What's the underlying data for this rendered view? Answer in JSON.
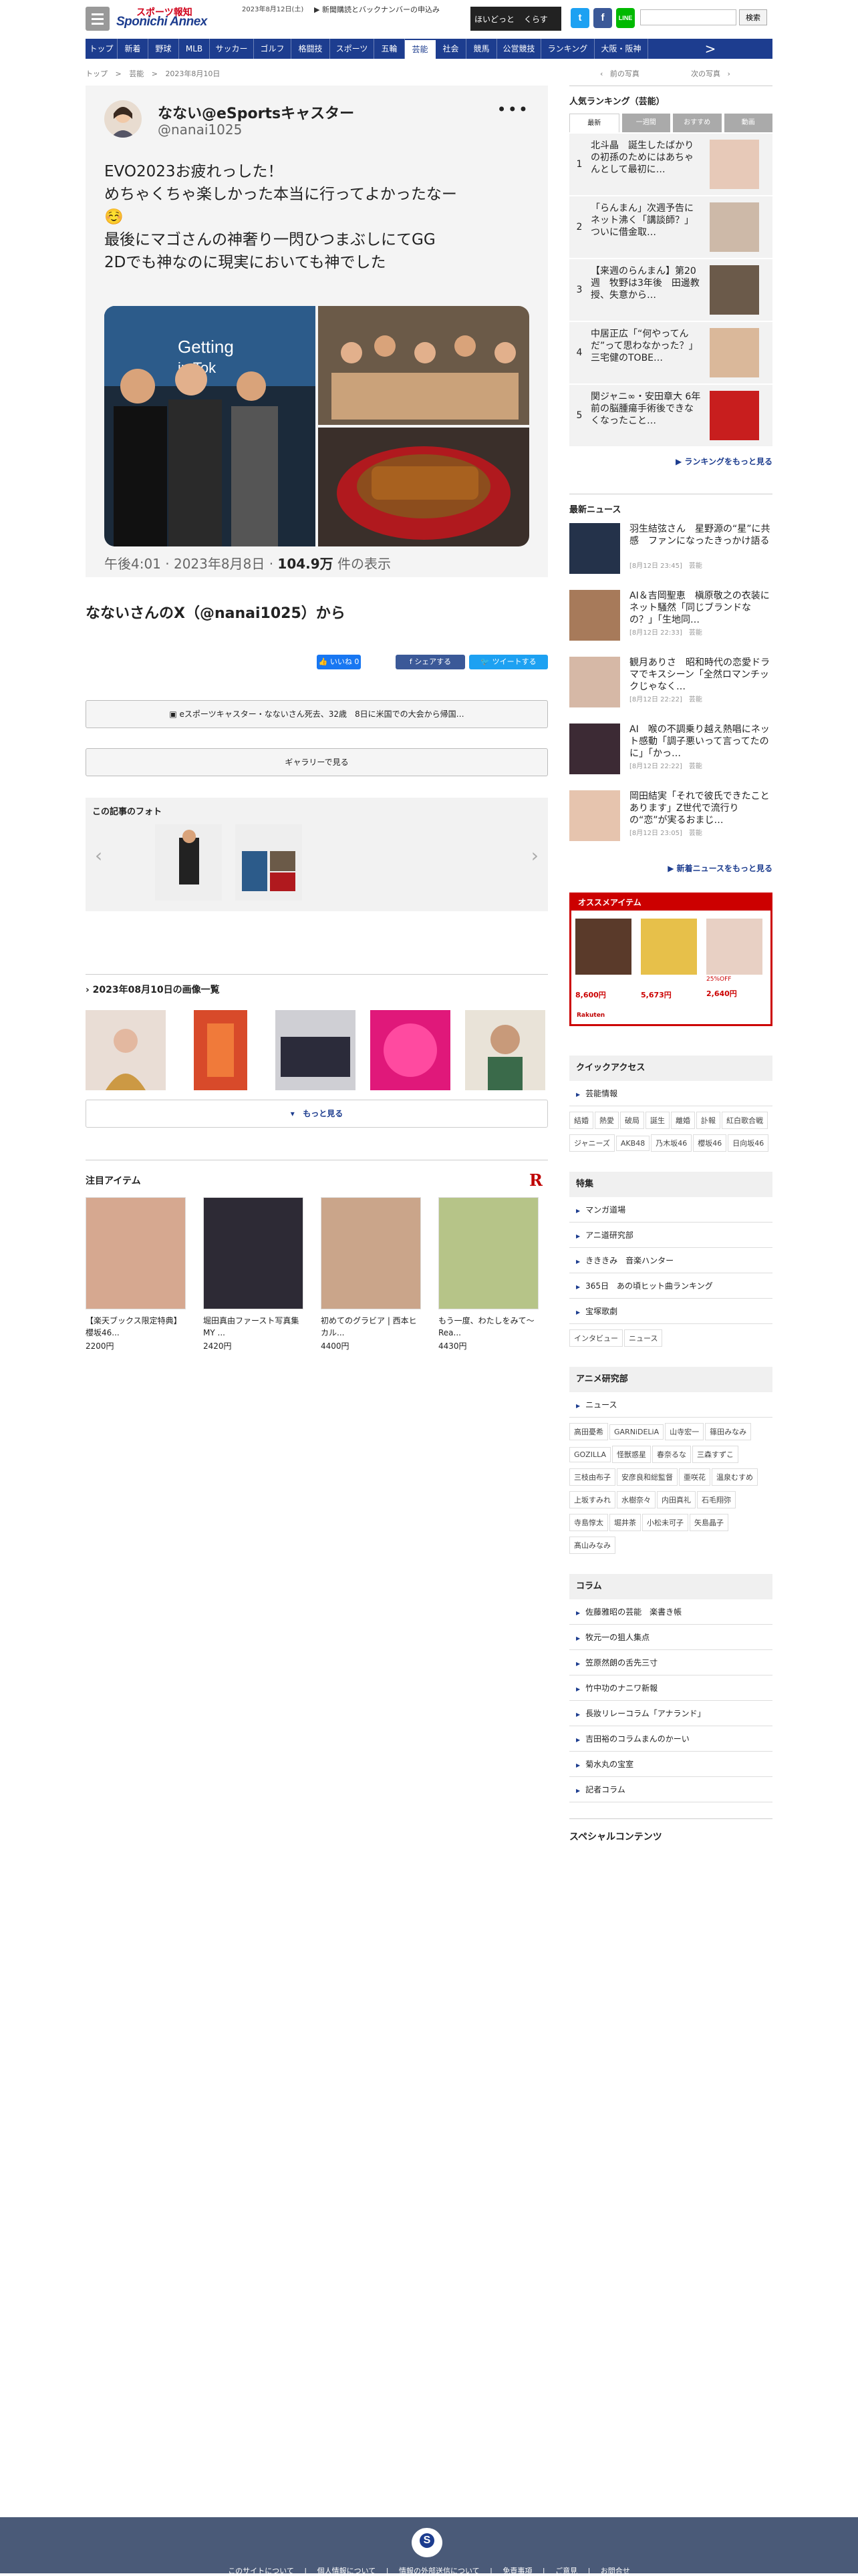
{
  "header": {
    "logo_top": "スポーツ報知",
    "logo_main": "Sponichi Annex",
    "date": "2023年8月12日(土)",
    "news_link": "新聞購読とバックナンバーの申込み",
    "ad_text_a": "ほいどっと",
    "ad_text_b": "くらす",
    "search_placeholder": "",
    "search_button": "検索",
    "colors": {
      "brand": "#1d3d8f",
      "twitter": "#1da1f2",
      "facebook": "#3b5998",
      "line": "#00b900"
    }
  },
  "nav": {
    "items": [
      "トップ",
      "新着",
      "野球",
      "MLB",
      "サッカー",
      "ゴルフ",
      "格闘技",
      "スポーツ",
      "五輪",
      "芸能",
      "社会",
      "競馬",
      "公営競技",
      "ランキング",
      "大阪・阪神"
    ],
    "active": "芸能",
    "more": ">"
  },
  "breadcrumb": {
    "items": [
      "トップ",
      ">",
      "芸能",
      ">",
      "2023年8月10日"
    ],
    "prev": "前の写真",
    "next": "次の写真"
  },
  "tweet": {
    "name": "なない@eSportsキャスター",
    "handle": "@nanai1025",
    "more": "•••",
    "lines": [
      "EVO2023お疲れっした！",
      "めちゃくちゃ楽しかった本当に行ってよかったなー",
      "☺️",
      "最後にマゴさんの神奢り一閃ひつまぶしにてGG",
      "2Dでも神なのに現実においても神でした"
    ],
    "time": "午後4:01 · 2023年8月8日 · ",
    "views_count": "104.9万",
    "views_label": " 件の表示"
  },
  "article": {
    "title": "なないさんのX（@nanai1025）から",
    "like": "いいね 0",
    "share_fb": "シェアする",
    "share_tw": "ツイートする",
    "related": "eスポーツキャスター・なないさん死去、32歳　8日に米国での大会から帰国…",
    "gallery": "ギャラリーで見る",
    "photos_title": "この記事のフォト",
    "day_title": "2023年08月10日の画像一覧",
    "more": "もっと見る"
  },
  "items": {
    "title": "注目アイテム",
    "logo": "R",
    "list": [
      {
        "title": "【楽天ブックス限定特典】櫻坂46...",
        "price": "2200円"
      },
      {
        "title": "堀田真由ファースト写真集 MY ...",
        "price": "2420円"
      },
      {
        "title": "初めてのグラビア | 西本ヒカル...",
        "price": "4400円"
      },
      {
        "title": "もう一度、わたしをみて〜Rea...",
        "price": "4430円"
      }
    ]
  },
  "ranking": {
    "title": "人気ランキング（芸能）",
    "tabs": [
      "最新",
      "一週間",
      "おすすめ",
      "動画"
    ],
    "rows": [
      {
        "n": "1",
        "t": "北斗晶　誕生したばかりの初孫のためにはあちゃんとして最初に…"
      },
      {
        "n": "2",
        "t": "「らんまん」次週予告にネット沸く「講談師？」ついに借金取…"
      },
      {
        "n": "3",
        "t": "【来週のらんまん】第20週　牧野は3年後　田邊教授、失意から…"
      },
      {
        "n": "4",
        "t": "中居正広「“何やってんだ”って思わなかった？」三宅健のTOBE…"
      },
      {
        "n": "5",
        "t": "関ジャニ∞・安田章大 6年前の脳腫瘍手術後できなくなったこと…"
      }
    ],
    "more": "ランキングをもっと見る"
  },
  "latest": {
    "title": "最新ニュース",
    "rows": [
      {
        "t": "羽生結弦さん　星野源の“星”に共感　ファンになったきっかけ語る",
        "d": "[8月12日 23:45]　芸能"
      },
      {
        "t": "AI＆吉岡聖恵　槇原敬之の衣装にネット騒然「同じブランドなの？」「生地同…",
        "d": "[8月12日 22:33]　芸能"
      },
      {
        "t": "観月ありさ　昭和時代の恋愛ドラマでキスシーン「全然ロマンチックじゃなく…",
        "d": "[8月12日 22:22]　芸能"
      },
      {
        "t": "AI　喉の不調乗り越え熱唱にネット感動「調子悪いって言ってたのに」「かっ…",
        "d": "[8月12日 22:22]　芸能"
      },
      {
        "t": "岡田結実「それで彼氏できたことあります」Z世代で流行りの“恋”が実るおまじ…",
        "d": "[8月12日 23:05]　芸能"
      }
    ],
    "more": "新着ニュースをもっと見る"
  },
  "reco": {
    "title": "オススメアイテム",
    "prices": [
      "8,600円",
      "5,673円",
      "2,640円"
    ],
    "badge": "25%OFF",
    "logo": "Rakuten"
  },
  "quick": {
    "title": "クイックアクセス",
    "link": "芸能情報",
    "tags": [
      "結婚",
      "熱愛",
      "破局",
      "誕生",
      "離婚",
      "訃報",
      "紅白歌合戦",
      "ジャニーズ",
      "AKB48",
      "乃木坂46",
      "櫻坂46",
      "日向坂46"
    ]
  },
  "feature": {
    "title": "特集",
    "links": [
      "マンガ道場",
      "アニ道研究部",
      "きききみ　音楽ハンター",
      "365日　あの頃ヒット曲ランキング",
      "宝塚歌劇"
    ],
    "tags": [
      "インタビュー",
      "ニュース"
    ]
  },
  "anime": {
    "title": "アニメ研究部",
    "link": "ニュース",
    "tags": [
      "高田憂希",
      "GARNiDELiA",
      "山寺宏一",
      "篠田みなみ",
      "GOZILLA",
      "怪獣惑星",
      "春奈るな",
      "三森すずこ",
      "三枝由布子",
      "安彦良和総監督",
      "亜咲花",
      "温泉むすめ",
      "上坂すみれ",
      "水樹奈々",
      "内田真礼",
      "石毛翔弥",
      "寺島惇太",
      "堀井茶",
      "小松未可子",
      "矢島晶子",
      "髙山みなみ"
    ]
  },
  "column": {
    "title": "コラム",
    "links": [
      "佐藤雅昭の芸能　楽書き帳",
      "牧元一の狙人集点",
      "笠原然朗の舌先三寸",
      "竹中功のナニワ新報",
      "長妝リレーコラム「アナランド」",
      "吉田裕のコラムまんのかーい",
      "菊水丸の宝室",
      "記者コラム"
    ]
  },
  "special": {
    "title": "スペシャルコンテンツ"
  },
  "footer": {
    "logo": "S",
    "links": [
      "このサイトについて",
      "|",
      "個人情報について",
      "|",
      "情報の外部送信について",
      "|",
      "免責事項",
      "|",
      "ご意見",
      "|",
      "お問合せ"
    ]
  }
}
